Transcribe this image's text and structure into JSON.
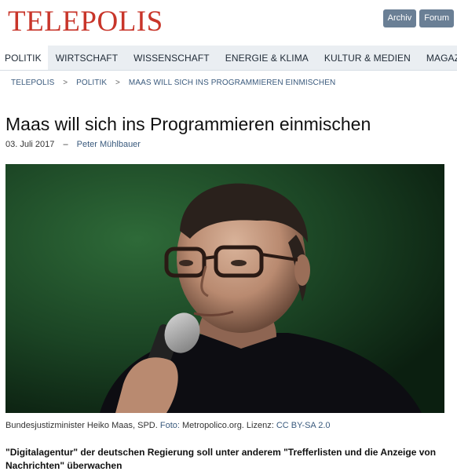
{
  "header": {
    "logo": "TELEPOLIS",
    "links": [
      "Archiv",
      "Forum"
    ]
  },
  "nav": {
    "items": [
      "POLITIK",
      "WIRTSCHAFT",
      "WISSENSCHAFT",
      "ENERGIE & KLIMA",
      "KULTUR & MEDIEN",
      "MAGAZIN"
    ],
    "active_index": 0
  },
  "breadcrumb": {
    "items": [
      "TELEPOLIS",
      "POLITIK",
      "MAAS WILL SICH INS PROGRAMMIEREN EINMISCHEN"
    ],
    "separator": ">"
  },
  "article": {
    "title": "Maas will sich ins Programmieren einmischen",
    "date": "03. Juli 2017",
    "dash": "–",
    "author": "Peter Mühlbauer",
    "caption_text": "Bundesjustizminister Heiko Maas, SPD. ",
    "caption_link1": "Foto:",
    "caption_mid": " Metropolico.org. Lizenz: ",
    "caption_link2": "CC BY-SA 2.0",
    "teaser": "\"Digitalagentur\" der deutschen Regierung soll unter anderem \"Trefferlisten und die Anzeige von Nachrichten\" überwachen"
  },
  "colors": {
    "logo": "#c8352a",
    "link": "#3a5a7d",
    "nav_bg": "#eaeef2",
    "button_bg": "#6a7f95"
  }
}
